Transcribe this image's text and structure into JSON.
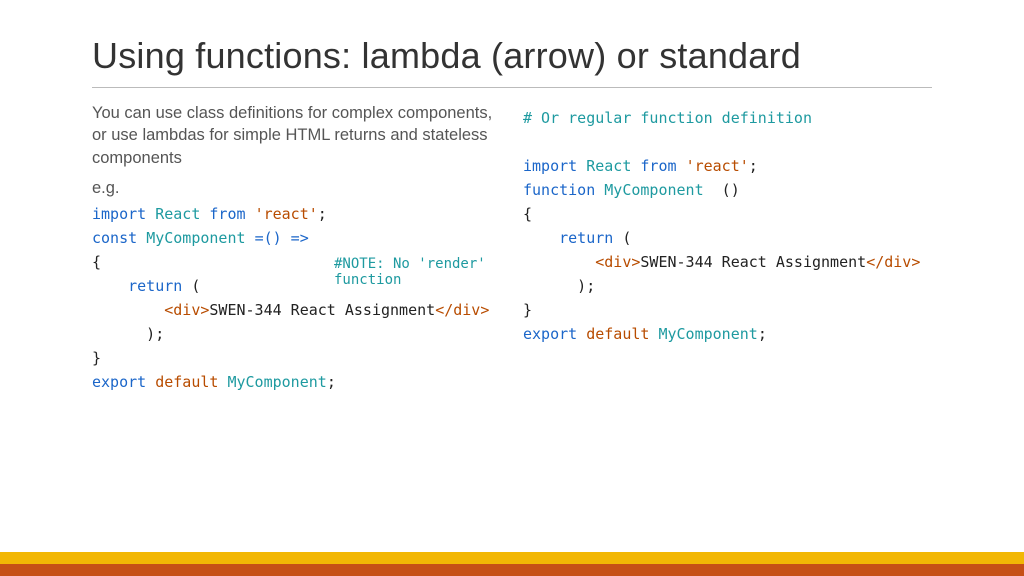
{
  "title": "Using functions: lambda (arrow) or standard",
  "intro": "You can use class definitions for complex components, or use lambdas for simple HTML returns and stateless components",
  "eg": "e.g.",
  "note": "#NOTE: No 'render' function",
  "left": {
    "l1": {
      "import": "import",
      "react": "React",
      "from": "from",
      "reactStr": "'react'",
      "semi": ";"
    },
    "l2": {
      "const": "const",
      "comp": "MyComponent",
      "op": "=() =>"
    },
    "l3": "{",
    "l4": {
      "indent": "    ",
      "return": "return",
      "paren": " ("
    },
    "l5": {
      "indent": "        ",
      "open": "<div>",
      "text": "SWEN-344 React Assignment",
      "close": "</div>"
    },
    "l6": "      );",
    "l7": "}",
    "l8": {
      "export": "export",
      "default": "default",
      "comp": "MyComponent",
      "semi": ";"
    }
  },
  "right": {
    "comment": "# Or regular function definition",
    "l1": {
      "import": "import",
      "react": "React",
      "from": "from",
      "reactStr": "'react'",
      "semi": ";"
    },
    "l2": {
      "function": "function",
      "comp": "MyComponent",
      "parens": "  ()"
    },
    "l3": "{",
    "l4": {
      "indent": "    ",
      "return": "return",
      "paren": " ("
    },
    "l5": {
      "indent": "        ",
      "open": "<div>",
      "text": "SWEN-344 React Assignment",
      "close": "</div>"
    },
    "l6": "      );",
    "l7": "}",
    "l8": {
      "export": "export",
      "default": "default",
      "comp": "MyComponent",
      "semi": ";"
    }
  }
}
